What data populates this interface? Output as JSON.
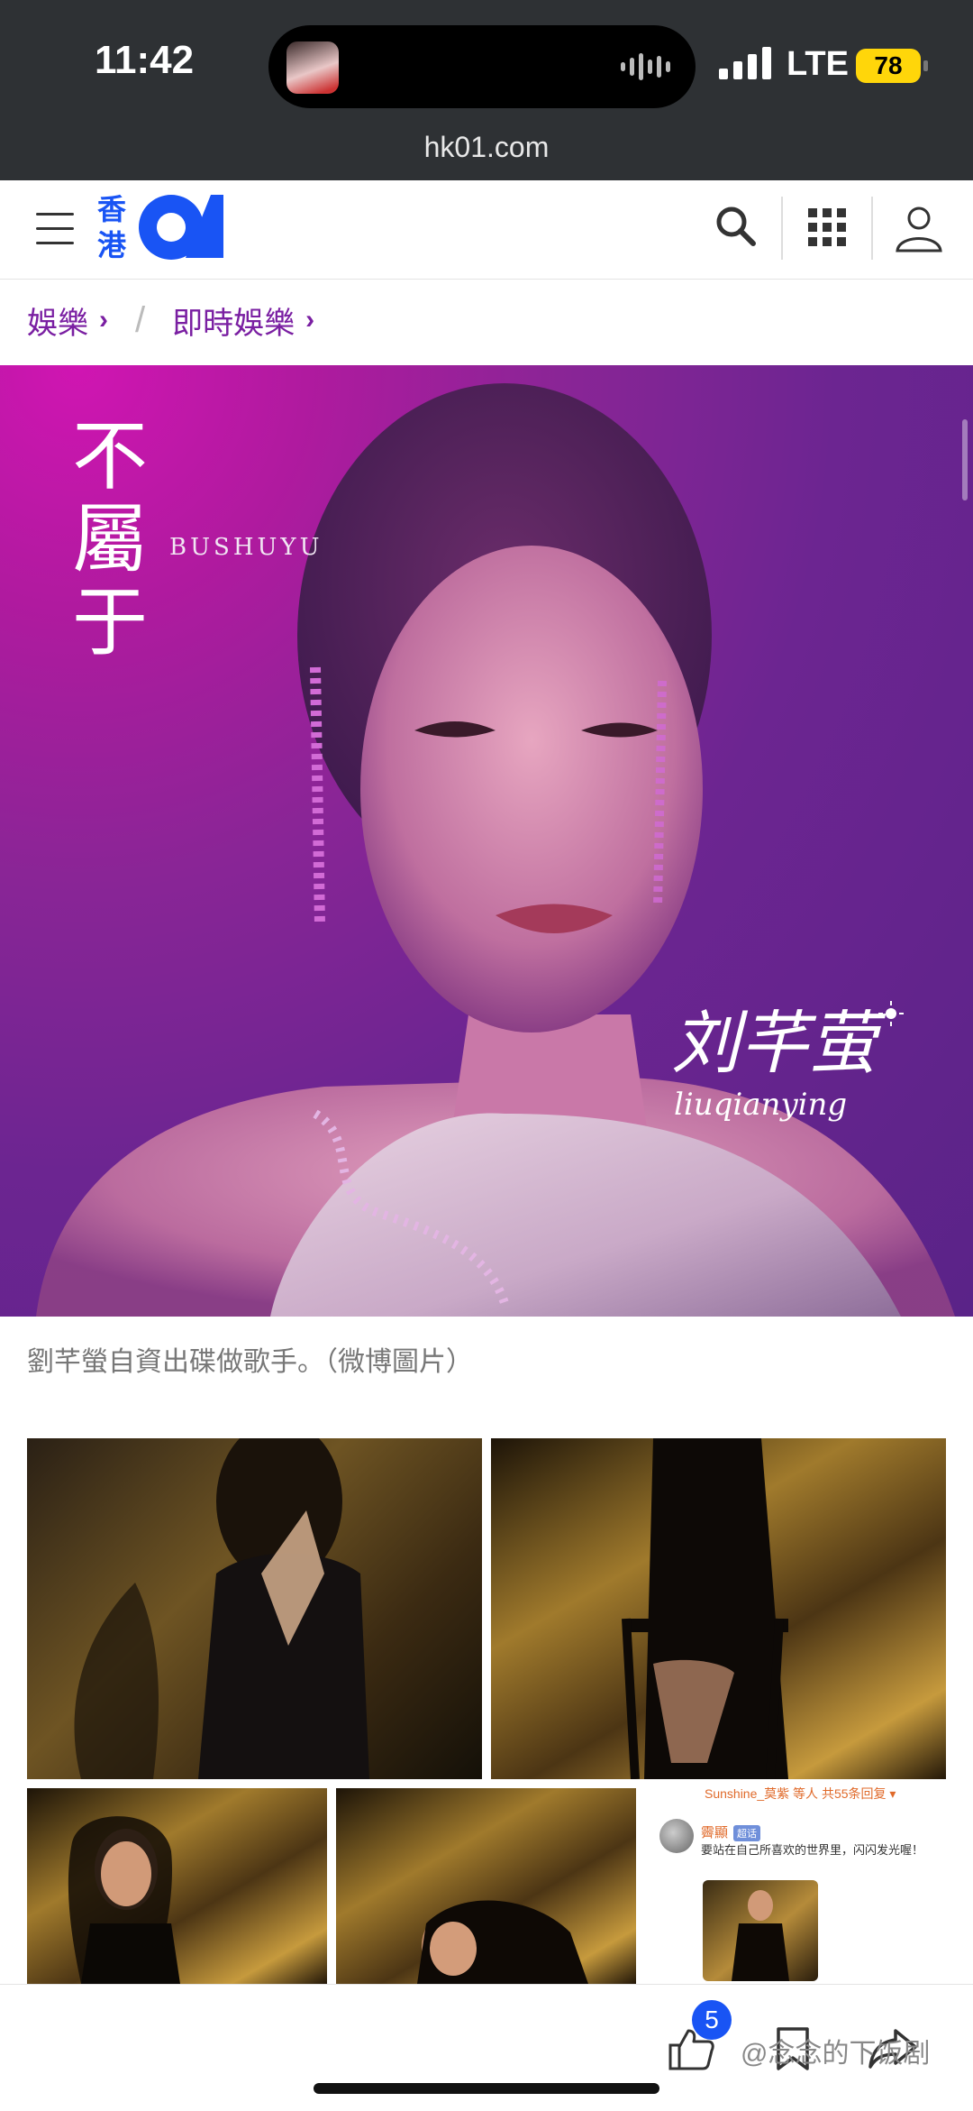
{
  "status_bar": {
    "time": "11:42",
    "network": "LTE",
    "battery": "78"
  },
  "browser": {
    "url": "hk01.com"
  },
  "site": {
    "logo_cjk": "香港",
    "logo_mark": "01"
  },
  "breadcrumb": {
    "items": [
      "娛樂",
      "即時娛樂"
    ]
  },
  "hero": {
    "title": "不屬于",
    "title_roman": "BUSHUYU",
    "artist_name": "刘芊萤",
    "artist_pinyin": "liuqianying"
  },
  "caption": "劉芊螢自資出碟做歌手。（微博圖片）",
  "weibo_snippet": {
    "header": "Sunshine_莫紫 等人 共55条回复 ▾",
    "username": "霽顯",
    "badge": "超话",
    "text": "要站在自己所喜欢的世界里，闪闪发光喔！"
  },
  "bottom_bar": {
    "like_count": "5"
  },
  "watermark": "@念念的下饭剧",
  "colors": {
    "brand_blue": "#1954f4",
    "breadcrumb_purple": "#7a1fa2",
    "status_bg": "#2e3134"
  }
}
